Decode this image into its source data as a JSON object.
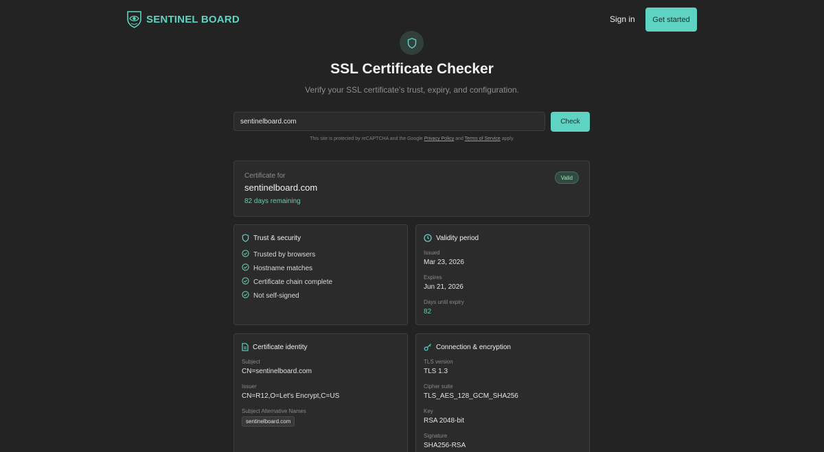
{
  "header": {
    "brand": "SENTINEL BOARD",
    "sign_in": "Sign in",
    "get_started": "Get started"
  },
  "hero": {
    "icon": "shield-icon",
    "title": "SSL Certificate Checker",
    "subtitle": "Verify your SSL certificate's trust, expiry, and configuration."
  },
  "search": {
    "value": "sentinelboard.com",
    "button": "Check",
    "recaptcha_prefix": "This site is protected by reCAPTCHA and the Google",
    "privacy_link": "Privacy Policy",
    "and": "and",
    "terms_link": "Terms of Service",
    "recaptcha_suffix": "apply."
  },
  "summary": {
    "label": "Certificate for",
    "domain": "sentinelboard.com",
    "days_remaining": "82 days remaining",
    "status": "Valid"
  },
  "trust": {
    "title": "Trust & security",
    "items": [
      "Trusted by browsers",
      "Hostname matches",
      "Certificate chain complete",
      "Not self-signed"
    ]
  },
  "validity": {
    "title": "Validity period",
    "issued_label": "Issued",
    "issued": "Mar 23, 2026",
    "expires_label": "Expires",
    "expires": "Jun 21, 2026",
    "days_label": "Days until expiry",
    "days": "82"
  },
  "identity": {
    "title": "Certificate identity",
    "subject_label": "Subject",
    "subject": "CN=sentinelboard.com",
    "issuer_label": "Issuer",
    "issuer": "CN=R12,O=Let's Encrypt,C=US",
    "san_label": "Subject Alternative Names",
    "san": [
      "sentinelboard.com"
    ]
  },
  "connection": {
    "title": "Connection & encryption",
    "tls_label": "TLS version",
    "tls": "TLS 1.3",
    "cipher_label": "Cipher suite",
    "cipher": "TLS_AES_128_GCM_SHA256",
    "key_label": "Key",
    "key": "RSA 2048-bit",
    "signature_label": "Signature",
    "signature": "SHA256-RSA"
  },
  "colors": {
    "background": "#232323",
    "card": "#2b2b2b",
    "accent": "#5fd3c3",
    "success": "#5fd3a2"
  }
}
